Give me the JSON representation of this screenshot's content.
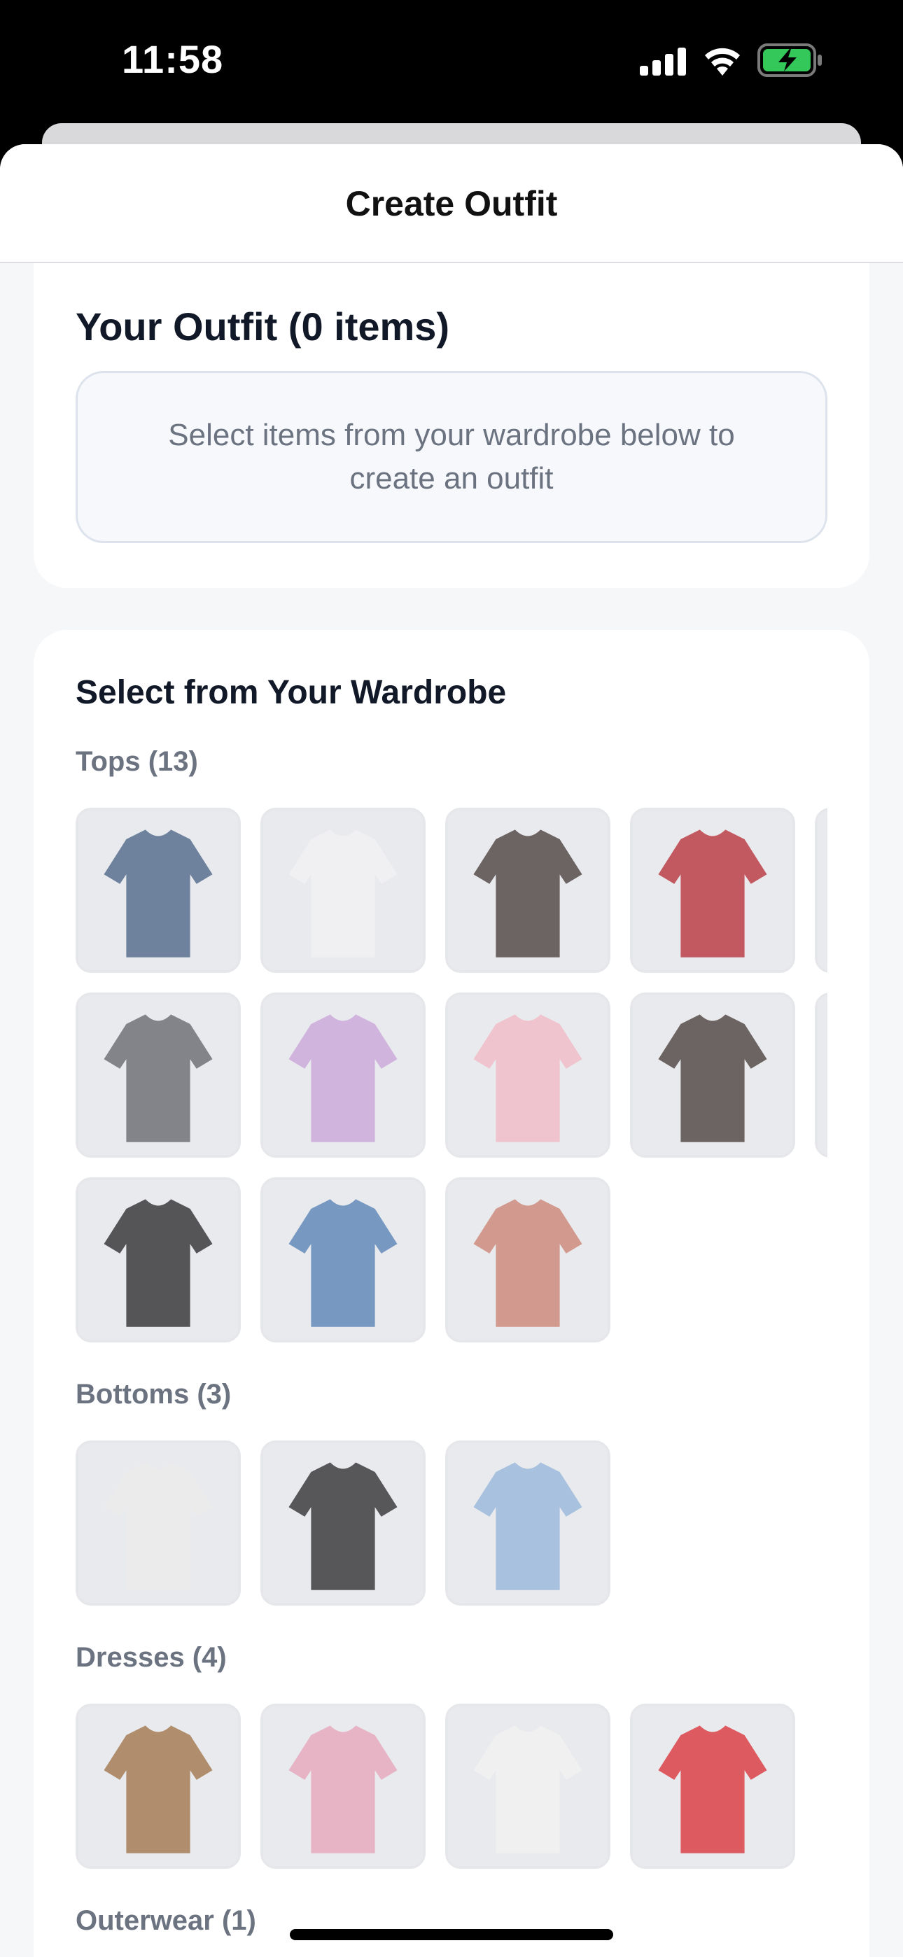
{
  "status_bar": {
    "time": "11:58"
  },
  "header": {
    "title": "Create Outfit"
  },
  "outfit": {
    "title": "Your Outfit (0 items)",
    "empty_message": "Select items from your wardrobe below to create an outfit"
  },
  "wardrobe": {
    "title": "Select from Your Wardrobe",
    "categories": [
      {
        "label": "Tops (13)"
      },
      {
        "label": "Bottoms (3)"
      },
      {
        "label": "Dresses (4)"
      },
      {
        "label": "Outerwear (1)"
      }
    ]
  },
  "colors": {
    "tops": [
      "#3f5a7e",
      "#f2f2f4",
      "#3b2f2e",
      "#b3202a",
      "#b7bcc2",
      "#5b5d62",
      "#c7a0d8",
      "#f1b6c2",
      "#3b302d",
      "#c9ccd1",
      "#1c1c1e",
      "#4a78b0",
      "#c97c6a"
    ],
    "bottoms": [
      "#ececec",
      "#1f1f21",
      "#8fb2d8"
    ],
    "dresses": [
      "#9a6a3a",
      "#e59fb5",
      "#f2f2f2",
      "#d8222a"
    ]
  }
}
